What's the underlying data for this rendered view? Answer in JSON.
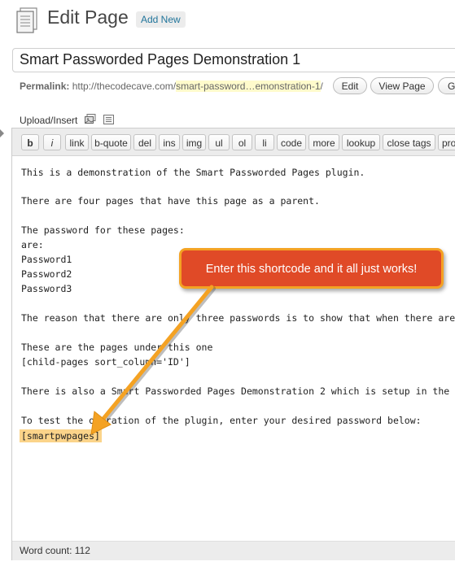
{
  "header": {
    "title": "Edit Page",
    "add_new_label": "Add New"
  },
  "post_title": {
    "value": "Smart Passworded Pages Demonstration 1"
  },
  "permalink": {
    "label": "Permalink:",
    "base": "http://thecodecave.com/",
    "slug": "smart-password…emonstration-1",
    "trailing": "/",
    "edit_label": "Edit",
    "view_page_label": "View Page",
    "get_shortlink_label": "G"
  },
  "media": {
    "label": "Upload/Insert",
    "icons": [
      "media-gallery-icon",
      "media-add-icon"
    ]
  },
  "quicktags": [
    "b",
    "i",
    "link",
    "b-quote",
    "del",
    "ins",
    "img",
    "ul",
    "ol",
    "li",
    "code",
    "more",
    "lookup",
    "close tags",
    "pro"
  ],
  "editor": {
    "lines": [
      "This is a demonstration of the Smart Passworded Pages plugin.",
      "",
      "There are four pages that have this page as a parent.",
      "",
      "The password for these pages:",
      "are:",
      "Password1",
      "Password2",
      "Password3",
      "",
      "The reason that there are only three passwords is to show that when there are",
      "",
      "These are the pages under this one",
      "[child-pages sort_column='ID']",
      "",
      "There is also a Smart Passworded Pages Demonstration 2 which is setup in the",
      "",
      "To test the operation of the plugin, enter your desired password below:",
      "[smartpwpages]"
    ],
    "word_count": "Word count: 112"
  },
  "annotation": {
    "text": "Enter this shortcode and it all just works!",
    "fill_color": "#e04a27",
    "border_color": "#f4a223"
  },
  "colors": {
    "link": "#21759b",
    "highlight": "#fffbcc",
    "shortcode_highlight": "#fbd48a"
  }
}
